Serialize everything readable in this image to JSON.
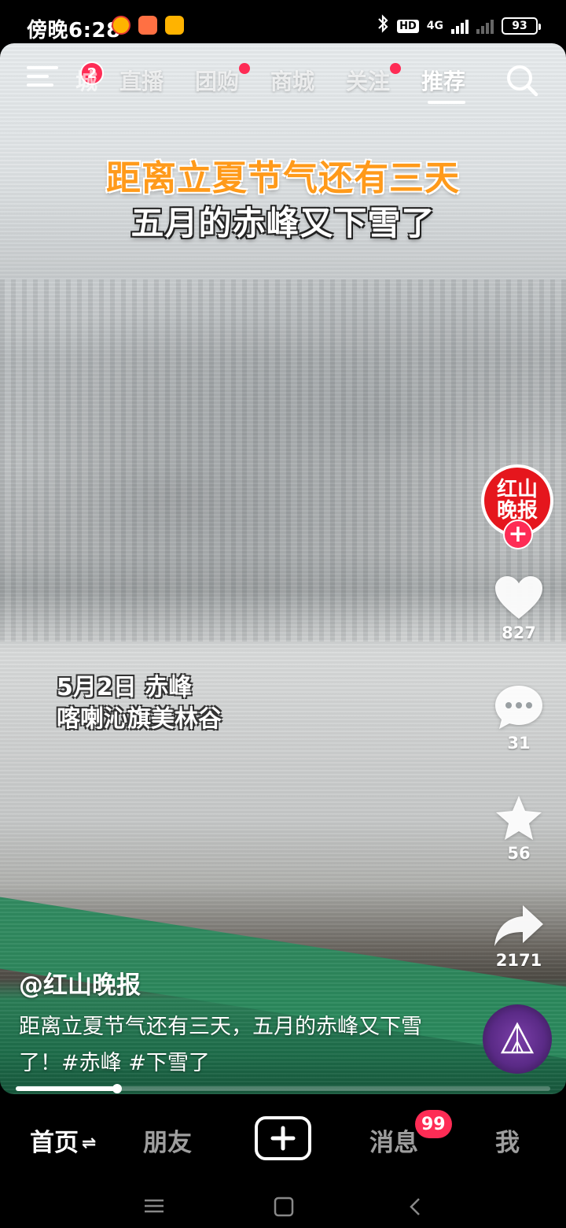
{
  "status_bar": {
    "time": "傍晚6:28",
    "hd": "HD",
    "network": "4G",
    "battery": "93"
  },
  "top_nav": {
    "menu_badge": "2",
    "partial_tab": "城",
    "tabs": [
      {
        "label": "直播",
        "dot": false
      },
      {
        "label": "团购",
        "dot": true
      },
      {
        "label": "商城",
        "dot": false
      },
      {
        "label": "关注",
        "dot": true
      },
      {
        "label": "推荐",
        "dot": false,
        "active": true
      }
    ]
  },
  "video": {
    "headline_1": "距离立夏节气还有三天",
    "headline_2": "五月的赤峰又下雪了",
    "location_1": "5月2日 赤峰",
    "location_2": "喀喇沁旗美林谷"
  },
  "side_actions": {
    "avatar_text": "红山晚报",
    "like_count": "827",
    "comment_count": "31",
    "favorite_count": "56",
    "share_count": "2171"
  },
  "post": {
    "author": "@红山晚报",
    "description": "距离立夏节气还有三天，五月的赤峰又下雪了！#赤峰 #下雪了",
    "progress": 0.19
  },
  "bottom_nav": {
    "home": "首页",
    "friends": "朋友",
    "messages": "消息",
    "messages_badge": "99",
    "me": "我"
  },
  "colors": {
    "accent": "#fe2c55",
    "headline_orange": "#ff9a1a",
    "avatar_red": "#e5161d"
  }
}
